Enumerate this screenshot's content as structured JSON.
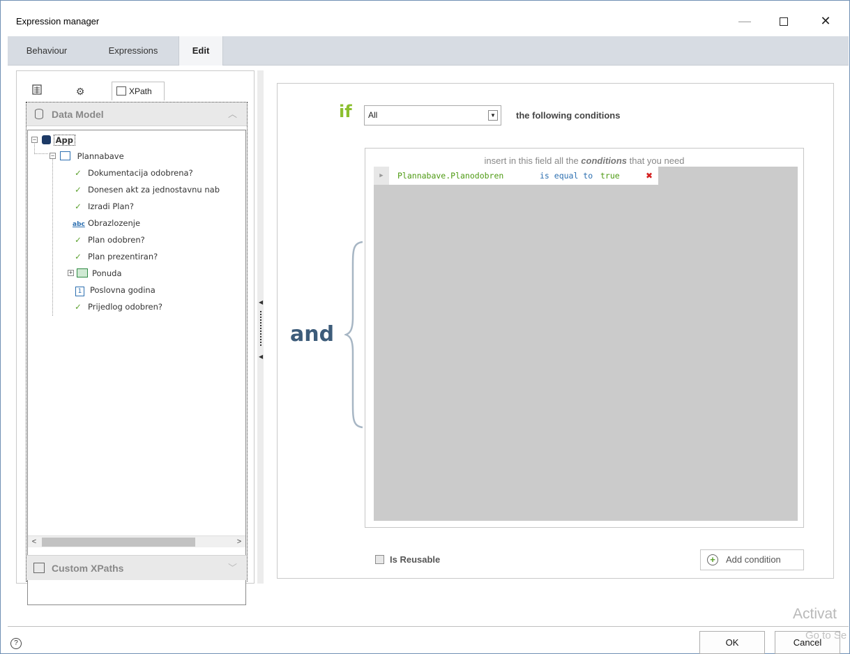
{
  "window": {
    "title": "Expression manager",
    "controls": {
      "minimize": "—",
      "maximize": "",
      "close": "✕"
    }
  },
  "tabs": [
    {
      "label": "Behaviour",
      "active": false
    },
    {
      "label": "Expressions",
      "active": false
    },
    {
      "label": "Edit",
      "active": true
    }
  ],
  "left_panel": {
    "toolbar": {
      "icons": [
        "table-icon",
        "gear-icon",
        "xpath-icon"
      ],
      "xpath_tab_label": "XPath"
    },
    "data_model": {
      "header": "Data Model",
      "tree": {
        "root": "App",
        "entity": "Plannabave",
        "items": [
          {
            "label": "Dokumentacija odobrena?",
            "icon": "check-icon"
          },
          {
            "label": "Donesen akt za jednostavnu nab",
            "icon": "check-icon"
          },
          {
            "label": "Izradi Plan?",
            "icon": "check-icon"
          },
          {
            "label": "Obrazlozenje",
            "icon": "abc-icon",
            "icon_text": "abc"
          },
          {
            "label": "Plan odobren?",
            "icon": "check-icon"
          },
          {
            "label": "Plan prezentiran?",
            "icon": "check-icon"
          },
          {
            "label": "Ponuda",
            "icon": "grid-icon",
            "expandable": true
          },
          {
            "label": "Poslovna godina",
            "icon": "number-icon",
            "icon_text": "1"
          },
          {
            "label": "Prijedlog odobren?",
            "icon": "check-icon"
          }
        ]
      },
      "scroll": {
        "left": "<",
        "right": ">"
      }
    },
    "custom_xpaths": {
      "header": "Custom XPaths"
    }
  },
  "editor": {
    "if_label": "if",
    "match_select": {
      "value": "All"
    },
    "following_text": "the following conditions",
    "and_label": "and",
    "hint": {
      "prefix": "insert in this field all the",
      "emphasis": "conditions",
      "suffix": "that you need"
    },
    "conditions": [
      {
        "field": "Plannabave.Planodobren",
        "operator": "is equal to",
        "value": "true",
        "delete": "✖"
      }
    ],
    "is_reusable_label": "Is Reusable",
    "add_condition_label": "Add condition"
  },
  "footer": {
    "help": "?",
    "ok_label": "OK",
    "cancel_label": "Cancel"
  },
  "watermark": {
    "line1": "Activat",
    "line2": "Go to Se"
  },
  "colors": {
    "if_green": "#8cbf2f",
    "and_blue": "#3d5c7a",
    "field_green": "#4d9a12",
    "operator_blue": "#2c6fb0",
    "delete_red": "#d42020",
    "condition_area_gray": "#cbcbcb",
    "tabbar_gray": "#d7dce3"
  }
}
